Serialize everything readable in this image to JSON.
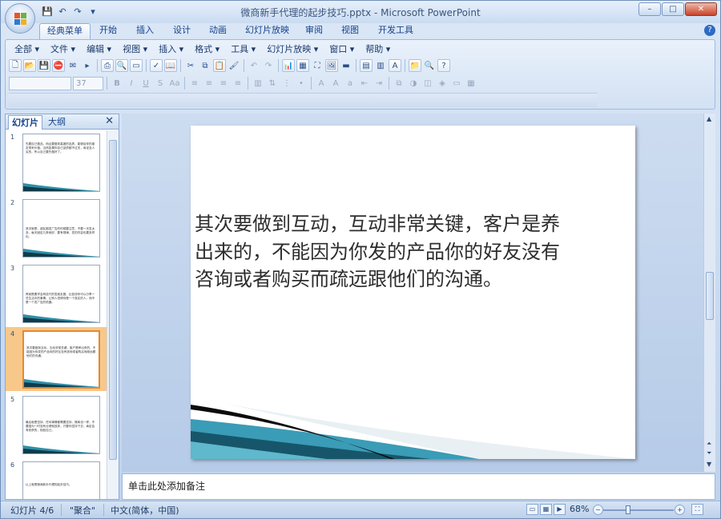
{
  "window": {
    "title": "微商新手代理的起步技巧.pptx - Microsoft PowerPoint",
    "controls": {
      "minimize": "–",
      "maximize": "□",
      "close": "✕"
    }
  },
  "quick_access": [
    "save-icon",
    "undo-icon",
    "redo-icon",
    "customize-icon"
  ],
  "tabs": [
    {
      "label": "经典菜单",
      "active": true
    },
    {
      "label": "开始"
    },
    {
      "label": "插入"
    },
    {
      "label": "设计"
    },
    {
      "label": "动画"
    },
    {
      "label": "幻灯片放映"
    },
    {
      "label": "审阅"
    },
    {
      "label": "视图"
    },
    {
      "label": "开发工具"
    }
  ],
  "menu": [
    {
      "label": "全部 ▾"
    },
    {
      "label": "文件 ▾"
    },
    {
      "label": "编辑 ▾"
    },
    {
      "label": "视图 ▾"
    },
    {
      "label": "插入 ▾"
    },
    {
      "label": "格式 ▾"
    },
    {
      "label": "工具 ▾"
    },
    {
      "label": "幻灯片放映 ▾"
    },
    {
      "label": "窗口 ▾"
    },
    {
      "label": "帮助 ▾"
    }
  ],
  "font": {
    "name": "",
    "size": "37"
  },
  "panel": {
    "tab_slides": "幻灯片",
    "tab_outline": "大纲",
    "close": "✕",
    "thumbs": [
      {
        "num": "1",
        "text": "先要自己做品，而且要做到高度的品质，能够给你的朋友带来价值，当然如果你自己品质都不过关，肯定没人买的，所以自己要先做好了。"
      },
      {
        "num": "2",
        "text": "其次就是，朋友圈发广告的时候要注意，不要一天发太多，每天固定几条就好，要有规律，发的内容也要多样化。"
      },
      {
        "num": "3",
        "text": "再就是要学会有技巧的发朋友圈，比如说你可以分享一些生活中的事情，让别人觉得你是一个真实的人，而不是一个发广告的机器。"
      },
      {
        "num": "4",
        "text": "其次要做到互动，互动非常关键，客户是养出来的，不能因为你发的产品你的好友没有咨询或者购买而疏远跟他们的沟通。",
        "selected": true
      },
      {
        "num": "5",
        "text": "最后就是坚持，任何事情都需要坚持，微商也一样，不要因为一时没有业绩就放弃，只要你坚持下去，肯定会有收获的，相信自己。"
      },
      {
        "num": "6",
        "text": "以上就是微商新手代理的起步技巧。"
      }
    ]
  },
  "slide": {
    "body": "其次要做到互动，互动非常关键，客户是养出来的，不能因为你发的产品你的好友没有咨询或者购买而疏远跟他们的沟通。"
  },
  "notes": {
    "placeholder": "单击此处添加备注"
  },
  "status": {
    "slide_indicator": "幻灯片 4/6",
    "theme": "\"聚合\"",
    "language": "中文(简体，中国)",
    "zoom": "68%",
    "zoom_fraction": 0.34
  },
  "colors": {
    "accent": "#15428b",
    "selected_thumb": "#e8872f",
    "wave_teal": "#2f8fa8"
  }
}
